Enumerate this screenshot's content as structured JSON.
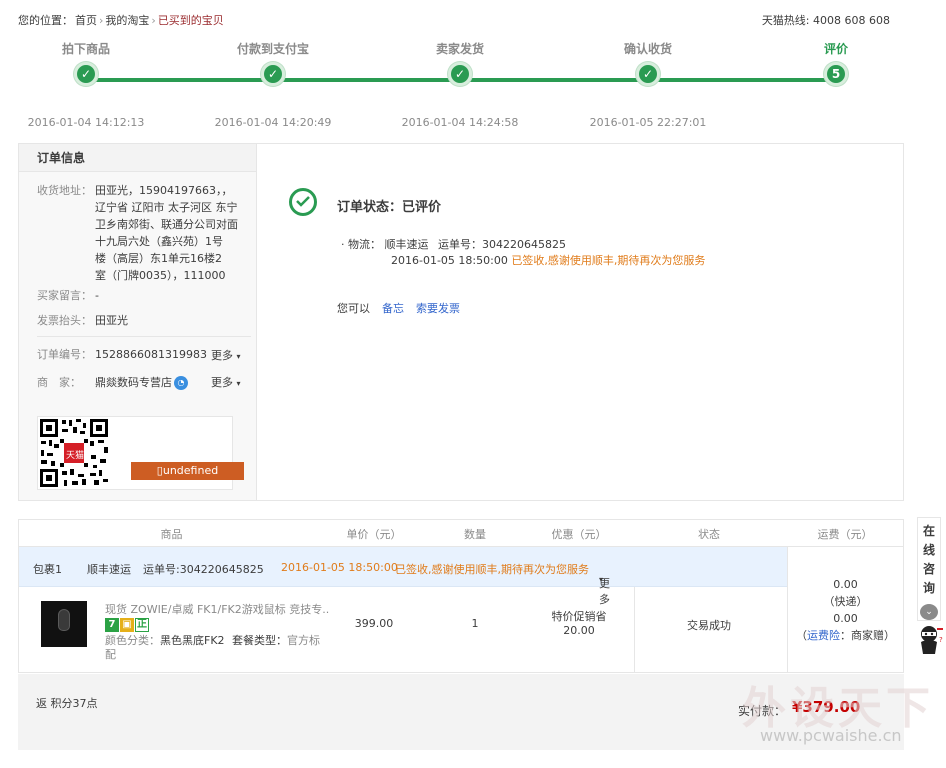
{
  "breadcrumb": {
    "prefix": "您的位置：",
    "items": [
      "首页",
      "我的淘宝",
      "已买到的宝贝"
    ]
  },
  "hotline": "天猫热线: 4008 608 608",
  "progress": {
    "steps": [
      {
        "label": "拍下商品",
        "mark": "✓",
        "time": "2016-01-04 14:12:13"
      },
      {
        "label": "付款到支付宝",
        "mark": "✓",
        "time": "2016-01-04 14:20:49"
      },
      {
        "label": "卖家发货",
        "mark": "✓",
        "time": "2016-01-04 14:24:58"
      },
      {
        "label": "确认收货",
        "mark": "✓",
        "time": "2016-01-05 22:27:01"
      },
      {
        "label": "评价",
        "mark": "5",
        "time": ""
      }
    ],
    "color": "#2a9b52"
  },
  "order_info": {
    "title": "订单信息",
    "address_label": "收货地址：",
    "address_lines": [
      "田亚光，15904197663，，",
      "辽宁省 辽阳市 太子河区 东宁",
      "卫乡南郊街、联通分公司对面",
      "十九局六处（鑫兴苑）1号",
      "楼（高层）东1单元16楼2",
      "室（门牌0035），111000"
    ],
    "message_label": "买家留言：",
    "message_value": "-",
    "invoice_label": "发票抬头：",
    "invoice_value": "田亚光",
    "order_no_label": "订单编号：",
    "order_no_value": "1528866081319983",
    "seller_label": "商　家：",
    "seller_value": "鼎燚数码专营店",
    "more_label": "更多",
    "qr_badge": "天猫",
    "qr_button": "▯undefined"
  },
  "status": {
    "text": "订单状态：已评价",
    "logistics_label": "· 物流：",
    "carrier": "顺丰速运",
    "waybill_label": "运单号：",
    "waybill": "304220645825",
    "time": "2016-01-05 18:50:00",
    "message": "已签收,感谢使用顺丰,期待再次为您服务",
    "ops_label": "您可以",
    "op1": "备忘",
    "op2": "索要发票"
  },
  "table": {
    "headers": [
      "商品",
      "单价（元）",
      "数量",
      "优惠（元）",
      "状态",
      "运费（元）"
    ],
    "package": {
      "name": "包裹1",
      "carrier": "顺丰速运",
      "waybill": "运单号:304220645825",
      "time": "2016-01-05 18:50:00",
      "message": "已签收,感谢使用顺丰,期待再次为您服务",
      "more": "更多"
    },
    "item": {
      "title": "现货 ZOWIE/卓威 FK1/FK2游戏鼠标 竞技专...",
      "badges": [
        "7",
        "▣",
        "正"
      ],
      "color_label": "颜色分类：",
      "color_value": "黑色黑底FK2",
      "package_label": "套餐类型：",
      "package_value": "官方标配",
      "price": "399.00",
      "qty": "1",
      "discount_label": "特价促销省",
      "discount_value": "20.00",
      "status": "交易成功"
    },
    "shipping": {
      "fee": "0.00",
      "mode": "（快递）",
      "insurance_fee": "0.00",
      "insurance_label": "运费险",
      "insurance_provider": "：商家赠）"
    }
  },
  "footer": {
    "points": "返 积分37点",
    "total_label": "实付款：",
    "total_value": "¥379.00"
  },
  "side": {
    "chars": [
      "在",
      "线",
      "咨",
      "询"
    ]
  },
  "watermark": {
    "main": "外设天下",
    "url": "www.pcwaishe.cn"
  }
}
